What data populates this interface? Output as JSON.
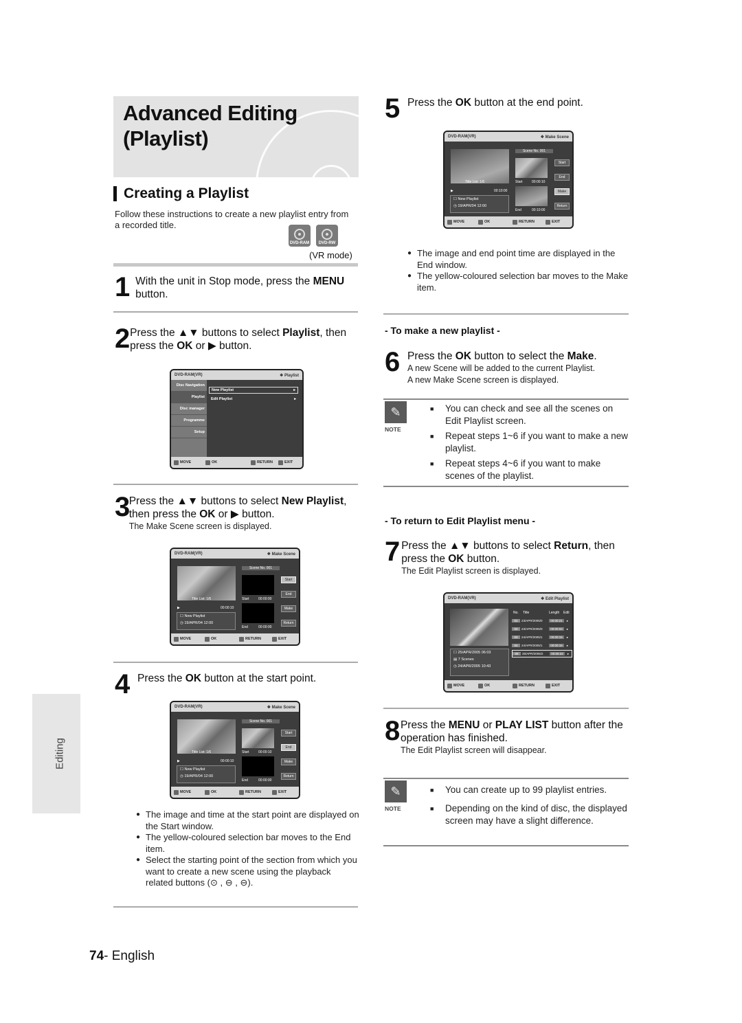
{
  "header": {
    "title_line1": "Advanced Editing",
    "title_line2": "(Playlist)"
  },
  "section": {
    "title": "Creating a Playlist",
    "intro": "Follow these instructions to create a new playlist entry from a recorded title.",
    "disc_icons": [
      "DVD-RAM",
      "DVD-RW"
    ],
    "mode": "(VR mode)"
  },
  "steps": [
    {
      "num": "1",
      "pre": "With the unit in Stop mode, press the ",
      "bold": "MENU",
      "post": " button."
    },
    {
      "num": "2",
      "pre": "Press the ▲▼ buttons to select ",
      "bold": "Playlist",
      "mid": ", then press the ",
      "bold2": "OK",
      "post": " or ▶ button."
    },
    {
      "num": "3",
      "pre": "Press the ▲▼ buttons to select ",
      "bold": "New Playlist",
      "mid": ", then press the ",
      "bold2": "OK",
      "post": " or ▶ button.",
      "sub": "The Make Scene screen is displayed."
    },
    {
      "num": "4",
      "pre": "Press the ",
      "bold": "OK",
      "post": " button at the start point."
    },
    {
      "num": "5",
      "pre": "Press the ",
      "bold": "OK",
      "post": " button at the end point."
    },
    {
      "num": "6",
      "pre": "Press the ",
      "bold": "OK",
      "mid": " button to select the ",
      "bold2": "Make",
      "post": ".",
      "sub1": "A new Scene will be added to the current Playlist.",
      "sub2": "A new Make Scene screen is displayed."
    },
    {
      "num": "7",
      "pre": "Press the ▲▼ buttons to select ",
      "bold": "Return",
      "mid": ", then press the ",
      "bold2": "OK",
      "post": " button.",
      "sub": "The Edit Playlist screen is displayed."
    },
    {
      "num": "8",
      "pre": "Press the ",
      "bold": "MENU",
      "mid": " or ",
      "bold2": "PLAY LIST",
      "post": " button after the operation has finished.",
      "sub": "The Edit Playlist screen will disappear."
    }
  ],
  "step4_bullets": [
    "The image and time at the start point are displayed on the Start window.",
    "The yellow-coloured selection bar moves to the End item.",
    "Select the starting point of the section from which you want to create a new scene using the playback related  buttons ("
  ],
  "step4_bullets_tail": ").",
  "step5_bullets": [
    "The image and end point time are displayed in the End window.",
    "The yellow-coloured selection bar moves to the Make  item."
  ],
  "subheads": {
    "make_new": "- To make a new playlist -",
    "return_menu": "- To return to Edit Playlist menu -"
  },
  "note1": {
    "label": "NOTE",
    "items": [
      "You can check and see all the scenes on Edit Playlist screen.",
      "Repeat steps 1~6 if you want to make a new playlist.",
      "Repeat steps 4~6 if you want to make scenes of the playlist."
    ]
  },
  "note2": {
    "label": "NOTE",
    "items": [
      "You can create up to 99 playlist entries.",
      "Depending on the kind of disc, the displayed screen may have a slight difference."
    ]
  },
  "osd_common": {
    "disc": "DVD-RAM(VR)",
    "move": "MOVE",
    "ok": "OK",
    "return": "RETURN",
    "exit": "EXIT"
  },
  "osd_menu": {
    "title": "❖ Playlist",
    "side": [
      "Disc Navigation",
      "Playlist",
      "Disc manager",
      "Programme",
      "Setup"
    ],
    "items": [
      "New Playlist",
      "Edit Playlist"
    ]
  },
  "osd_make": {
    "title": "❖ Make Scene",
    "scene_no": "Scene No. 001",
    "title_list": "Title List: 1/6",
    "playlist": "New Playlist",
    "date": "19/APR/04 12:00",
    "start": "Start",
    "end": "End",
    "buttons": [
      "Start",
      "End",
      "Make",
      "Return"
    ],
    "screens": [
      {
        "pos": "00:00:10",
        "start_time": "00:00:00",
        "end_time": "00:00:00",
        "selected": "Start"
      },
      {
        "pos": "00:00:10",
        "start_time": "00:00:10",
        "end_time": "00:00:00",
        "selected": "End"
      },
      {
        "pos": "00:10:00",
        "start_time": "00:00:10",
        "end_time": "00:10:00",
        "selected": "Make"
      }
    ]
  },
  "osd_edit": {
    "title": "❖ Edit Playlist",
    "cols": [
      "No.",
      "Title",
      "Length",
      "Edit"
    ],
    "rows": [
      {
        "no": "01",
        "title": "23/APR/2005/0",
        "length": "00:00:21"
      },
      {
        "no": "02",
        "title": "23/APR/2005/0",
        "length": "00:00:03"
      },
      {
        "no": "03",
        "title": "24/APR/2005/1",
        "length": "00:00:15"
      },
      {
        "no": "04",
        "title": "24/APR/2005/1",
        "length": "00:00:16"
      },
      {
        "no": "05",
        "title": "25/APR/2005/2",
        "length": "00:06:32"
      }
    ],
    "info": [
      "25/APR/2005 06:03",
      "7 Scenes",
      "24/APR/2005 10:43"
    ]
  },
  "side_tab": "Editing",
  "footer": {
    "page": "74",
    "lang": "- English"
  }
}
